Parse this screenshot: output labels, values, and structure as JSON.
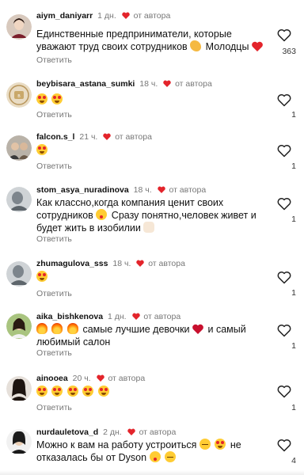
{
  "comments": [
    {
      "username": "aiym_daniyarr",
      "time": "1 дн.",
      "from_author": "от автора",
      "text": "Единственные предприниматели, которые уважают труд своих сотрудников",
      "text_tail": "Молодцы",
      "reply": "Ответить",
      "likes": "363"
    },
    {
      "username": "beybisara_astana_sumki",
      "time": "18 ч.",
      "from_author": "от автора",
      "reply": "Ответить",
      "likes": "1"
    },
    {
      "username": "falcon.s_l",
      "time": "21 ч.",
      "from_author": "от автора",
      "reply": "Ответить",
      "likes": "1"
    },
    {
      "username": "stom_asya_nuradinova",
      "time": "18 ч.",
      "from_author": "от автора",
      "text": "Как классно,когда компания ценит своих сотрудников",
      "text_tail": "Сразу понятно,человек живет и будет жить в изобилии",
      "reply": "Ответить",
      "likes": "1"
    },
    {
      "username": "zhumagulova_sss",
      "time": "18 ч.",
      "from_author": "от автора",
      "reply": "Ответить",
      "likes": "1"
    },
    {
      "username": "aika_bishkenova",
      "time": "1 дн.",
      "from_author": "от автора",
      "text": "самые лучшие девочки",
      "text_tail": "и самый любимый салон",
      "reply": "Ответить",
      "likes": "1"
    },
    {
      "username": "ainooea",
      "time": "20 ч.",
      "from_author": "от автора",
      "reply": "Ответить",
      "likes": "1"
    },
    {
      "username": "nurdauletova_d",
      "time": "2 дн.",
      "from_author": "от автора",
      "text": "Можно к вам на работу устроиться",
      "text_tail": "не отказалась бы от Dyson",
      "reply": "Ответить",
      "likes": "4"
    }
  ],
  "icons": {
    "author_heart": "heart-icon",
    "like": "heart-outline-icon"
  },
  "colors": {
    "author_heart": "#e3242b",
    "muted": "#777777"
  }
}
